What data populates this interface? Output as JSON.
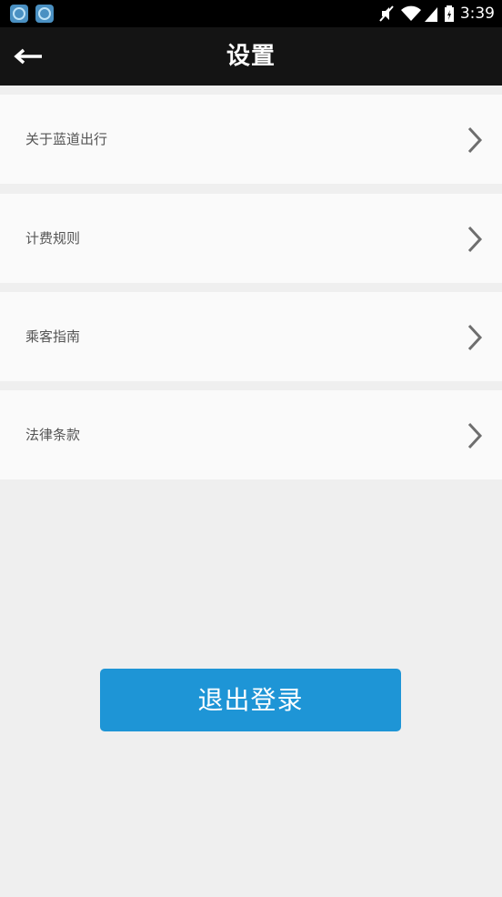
{
  "status_bar": {
    "time": "3:39",
    "notification_icons": [
      "app-notification-icon",
      "app-notification-icon"
    ],
    "icons": [
      "mute-icon",
      "wifi-icon",
      "signal-icon",
      "battery-icon"
    ]
  },
  "header": {
    "title": "设置",
    "back_icon": "back-arrow-icon"
  },
  "menu": {
    "items": [
      {
        "label": "关于蓝道出行",
        "icon": "chevron-right-icon"
      },
      {
        "label": "计费规则",
        "icon": "chevron-right-icon"
      },
      {
        "label": "乘客指南",
        "icon": "chevron-right-icon"
      },
      {
        "label": "法律条款",
        "icon": "chevron-right-icon"
      }
    ]
  },
  "logout": {
    "label": "退出登录",
    "color": "#1e95d6"
  },
  "colors": {
    "header_bg": "#141414",
    "page_bg": "#efefef",
    "row_bg": "#fafafa",
    "accent": "#1e95d6"
  }
}
